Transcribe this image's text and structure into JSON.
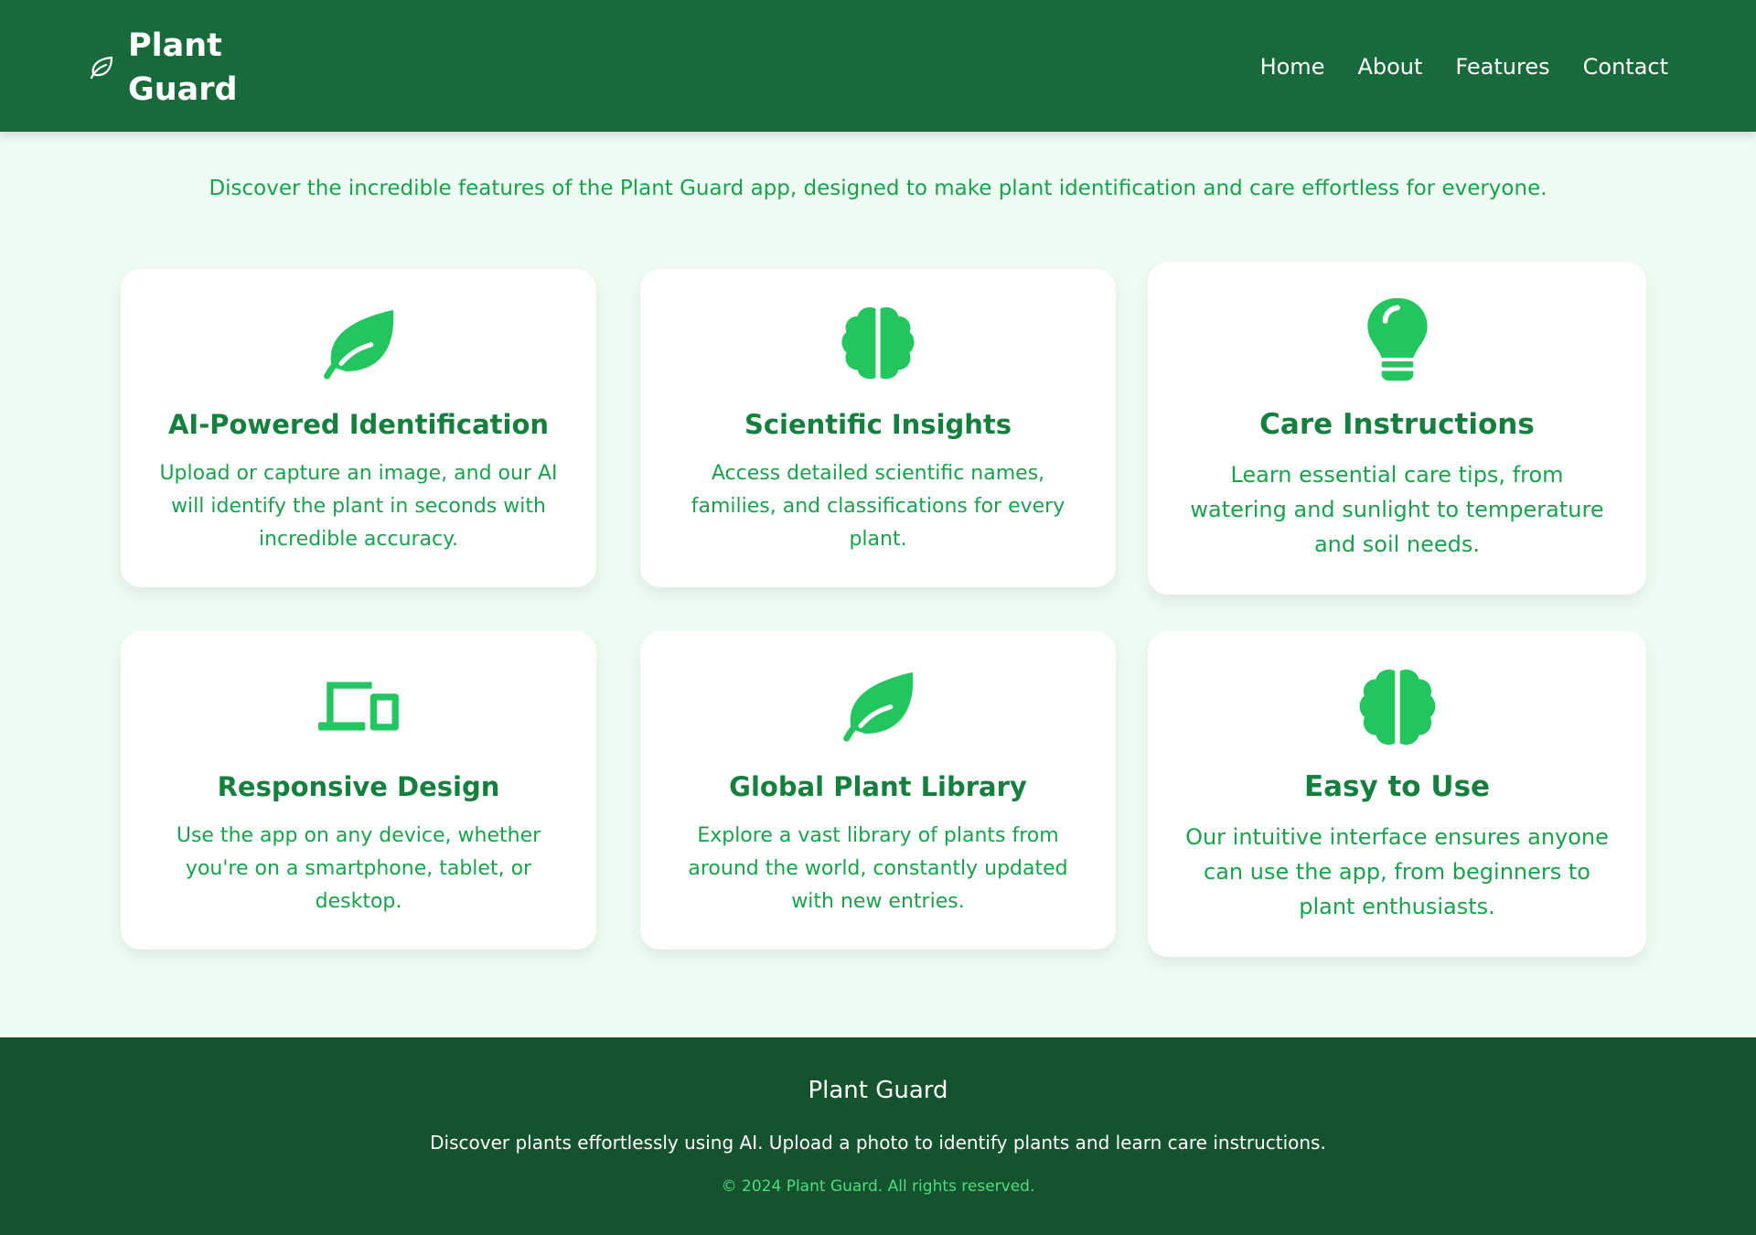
{
  "header": {
    "brand": "Plant Guard",
    "brand_icon": "leaf-outline-icon",
    "nav": [
      "Home",
      "About",
      "Features",
      "Contact"
    ]
  },
  "intro": "Discover the incredible features of the Plant Guard app, designed to make plant identification and care effortless for everyone.",
  "features": [
    {
      "icon": "leaf-icon",
      "title": "AI-Powered Identification",
      "desc": "Upload or capture an image, and our AI will identify the plant in seconds with incredible accuracy."
    },
    {
      "icon": "brain-icon",
      "title": "Scientific Insights",
      "desc": "Access detailed scientific names, families, and classifications for every plant."
    },
    {
      "icon": "lightbulb-icon",
      "title": "Care Instructions",
      "desc": "Learn essential care tips, from watering and sunlight to temperature and soil needs."
    },
    {
      "icon": "devices-icon",
      "title": "Responsive Design",
      "desc": "Use the app on any device, whether you're on a smartphone, tablet, or desktop."
    },
    {
      "icon": "leaf-icon",
      "title": "Global Plant Library",
      "desc": "Explore a vast library of plants from around the world, constantly updated with new entries."
    },
    {
      "icon": "brain-icon",
      "title": "Easy to Use",
      "desc": "Our intuitive interface ensures anyone can use the app, from beginners to plant enthusiasts."
    }
  ],
  "footer": {
    "title": "Plant Guard",
    "desc": "Discover plants effortlessly using AI. Upload a photo to identify plants and learn care instructions.",
    "copyright": "© 2024 Plant Guard. All rights reserved."
  },
  "colors": {
    "header": "#186a3b",
    "background": "#effcf3",
    "accent": "#22c55e",
    "title": "#15803d",
    "text": "#16a34a",
    "footer": "#14532d",
    "footer_copy": "#4ade80"
  }
}
